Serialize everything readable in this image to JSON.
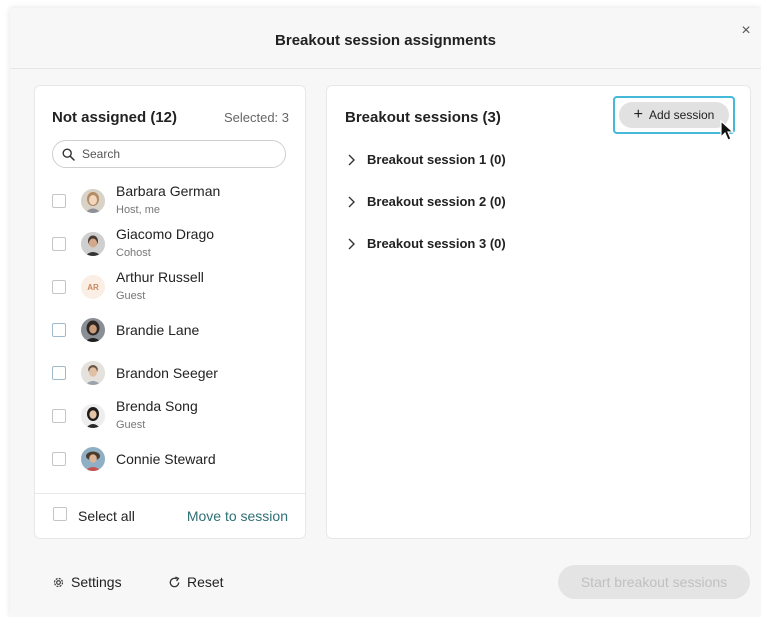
{
  "dialog": {
    "title": "Breakout session assignments",
    "close_glyph": "×"
  },
  "unassigned": {
    "title": "Not assigned (12)",
    "selected": "Selected: 3",
    "search_placeholder": "Search",
    "participants": [
      {
        "name": "Barbara German",
        "role": "Host, me",
        "avatar": "photo"
      },
      {
        "name": "Giacomo Drago",
        "role": "Cohost",
        "avatar": "photo"
      },
      {
        "name": "Arthur Russell",
        "role": "Guest",
        "avatar": "initials",
        "initials": "AR"
      },
      {
        "name": "Brandie Lane",
        "role": "",
        "avatar": "photo"
      },
      {
        "name": "Brandon Seeger",
        "role": "",
        "avatar": "photo"
      },
      {
        "name": "Brenda Song",
        "role": "Guest",
        "avatar": "photo"
      },
      {
        "name": "Connie Steward",
        "role": "",
        "avatar": "photo"
      }
    ],
    "select_all": "Select all",
    "move_to_session": "Move to session"
  },
  "sessions": {
    "title": "Breakout sessions (3)",
    "add_button": "Add session",
    "items": [
      {
        "label": "Breakout session 1 (0)"
      },
      {
        "label": "Breakout session 2 (0)"
      },
      {
        "label": "Breakout session 3 (0)"
      }
    ]
  },
  "footer": {
    "settings": "Settings",
    "reset": "Reset",
    "start": "Start breakout sessions"
  },
  "colors": {
    "accent_link": "#2f6f75",
    "focus_ring": "#44b9d8"
  }
}
